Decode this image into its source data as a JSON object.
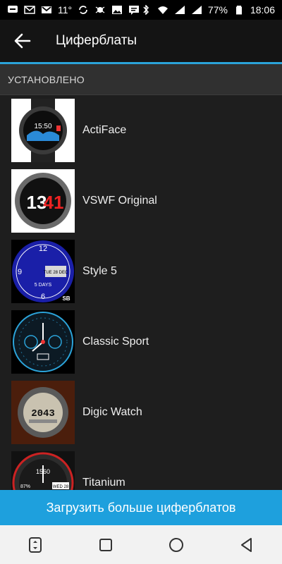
{
  "status_bar": {
    "notification_icons": [
      "sms-icon",
      "mail-icon",
      "gmail-icon",
      "sync-icon",
      "bug-icon",
      "image-icon",
      "chat-icon"
    ],
    "temperature": "11°",
    "battery": "77%",
    "time": "18:06"
  },
  "app_bar": {
    "title": "Циферблаты"
  },
  "section": {
    "header": "УСТАНОВЛЕНО"
  },
  "watchfaces": [
    {
      "name": "ActiFace"
    },
    {
      "name": "VSWF Original"
    },
    {
      "name": "Style 5"
    },
    {
      "name": "Classic Sport"
    },
    {
      "name": "Digic Watch"
    },
    {
      "name": "Titanium"
    }
  ],
  "thumb_text": {
    "actiface_time": "15:50",
    "vswf_hour": "13",
    "vswf_min": "41",
    "style5_date": "TUE 28 DEC",
    "style5_days": "5 DAYS",
    "style5_tag": "SB",
    "digic_time": "2043",
    "titanium_steps": "1560",
    "titanium_pct": "87%",
    "titanium_day": "WED 28"
  },
  "bottom_button": {
    "label": "Загрузить больше циферблатов"
  },
  "colors": {
    "accent": "#2ba3d9",
    "button": "#1ea0dd",
    "background": "#1e1e1e"
  }
}
